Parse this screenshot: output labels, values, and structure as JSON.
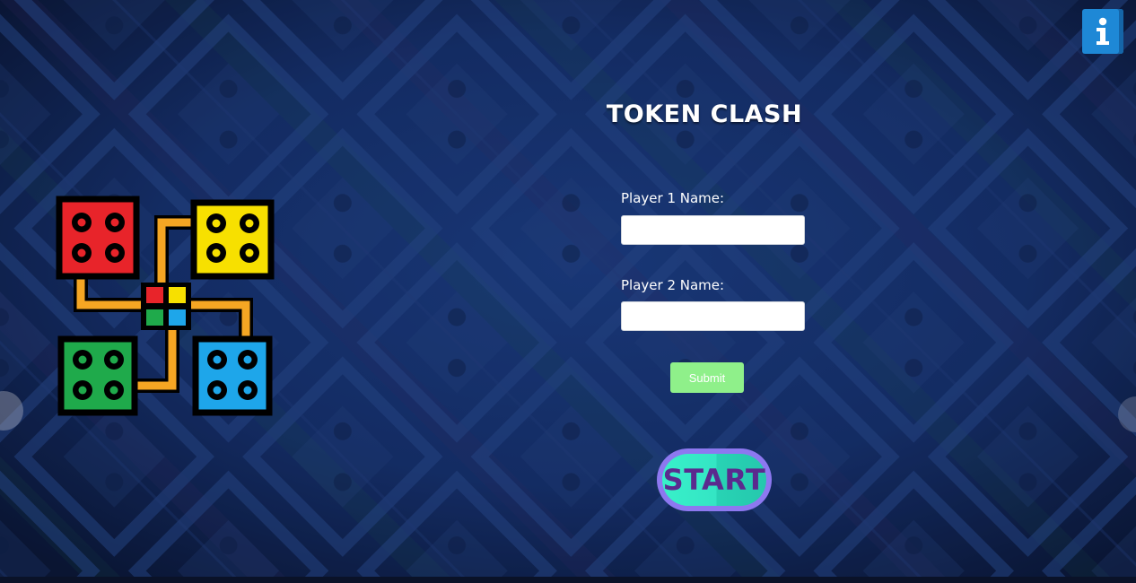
{
  "game": {
    "title": "TOKEN CLASH"
  },
  "form": {
    "player1_label": "Player 1 Name:",
    "player1_value": "",
    "player2_label": "Player 2 Name:",
    "player2_value": "",
    "submit_label": "Submit"
  },
  "start": {
    "label": "START"
  },
  "toolbar": {
    "info_icon": "info-icon"
  },
  "logo": {
    "icon": "ludo-board-icon",
    "colors": {
      "red": "#e8242a",
      "yellow": "#f7e000",
      "green": "#1faa4b",
      "blue": "#1ea6ea",
      "path": "#f5a623"
    }
  },
  "colors": {
    "background": "#12285a",
    "submit": "#8ff08a",
    "start_face": "#38f0c9",
    "start_rim": "#8d78f0",
    "start_text": "#5b2a8e",
    "info": "#1e88d6"
  }
}
